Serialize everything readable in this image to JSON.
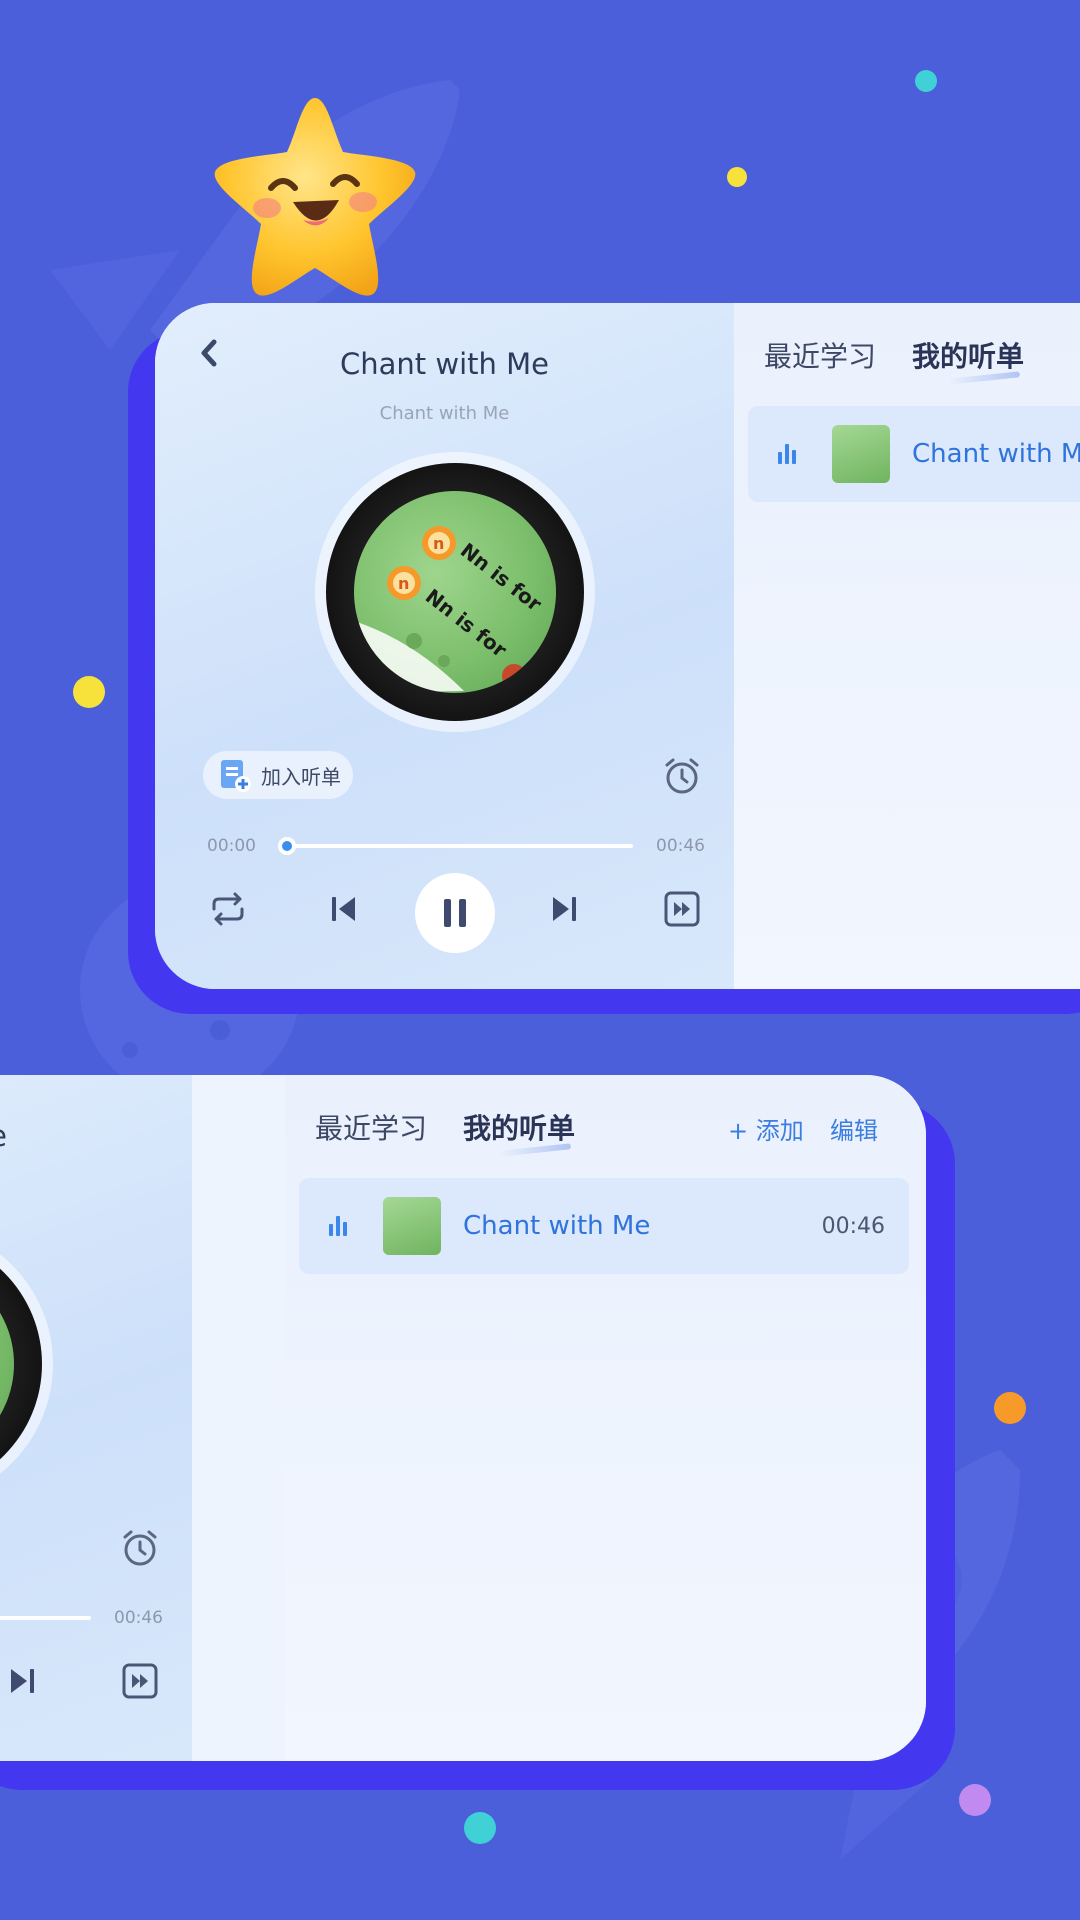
{
  "player": {
    "title": "Chant with Me",
    "subtitle": "Chant with Me",
    "add_to_list_label": "加入听单",
    "time_current": "00:00",
    "time_total": "00:46",
    "progress": 0.0
  },
  "list_panel": {
    "tabs": [
      {
        "label": "最近学习",
        "active": false
      },
      {
        "label": "我的听单",
        "active": true
      }
    ],
    "add_label": "+ 添加",
    "edit_label": "编辑",
    "items": [
      {
        "title": "Chant with Me",
        "duration": "00:46",
        "playing": true
      }
    ]
  },
  "disc_art_text": [
    "Nn is for",
    "Nn is for"
  ],
  "colors": {
    "background": "#4a5fd9",
    "card_shadow": "#4338f0",
    "accent_blue": "#3b7de0",
    "progress_dot": "#3b8ef0"
  },
  "icons": [
    "back-icon",
    "add-list-icon",
    "alarm-icon",
    "repeat-icon",
    "prev-icon",
    "pause-icon",
    "next-icon",
    "speed-icon",
    "equalizer-icon"
  ]
}
